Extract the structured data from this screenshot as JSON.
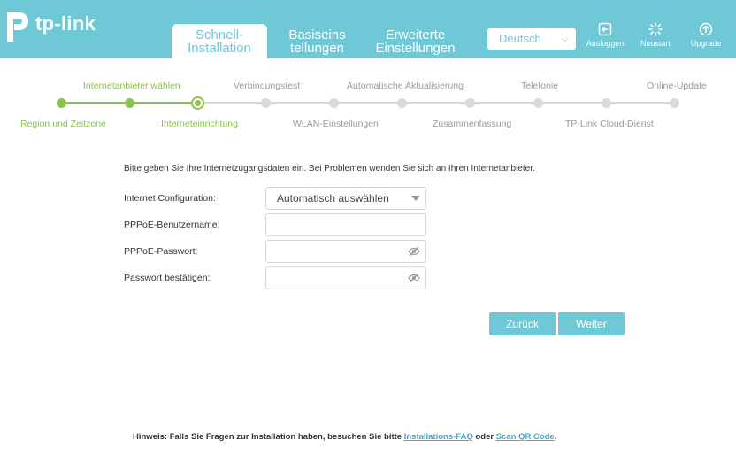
{
  "header": {
    "logo_text": "tp-link",
    "tabs": [
      {
        "line1": "Schnell-",
        "line2": "Installation"
      },
      {
        "line1": "Basiseins",
        "line2": "tellungen"
      },
      {
        "line1": "Erweiterte",
        "line2": "Einstellungen"
      }
    ],
    "language": "Deutsch",
    "buttons": {
      "logout": "Ausloggen",
      "reboot": "Neustart",
      "upgrade": "Upgrade"
    }
  },
  "steps": {
    "top": [
      "Internetanbieter wählen",
      "Verbindungstest",
      "Automatische Aktualisierung",
      "Telefonie",
      "Online-Update"
    ],
    "bottom": [
      "Region und Zeitzone",
      "Interneteinrichtung",
      "WLAN-Einstellungen",
      "Zusammenfassung",
      "TP-Link Cloud-Dienst"
    ]
  },
  "form": {
    "intro": "Bitte geben Sie Ihre Internetzugangsdaten ein. Bei Problemen wenden Sie sich an Ihren Internetanbieter.",
    "config_label": "Internet Configuration:",
    "config_value": "Automatisch auswählen",
    "username_label": "PPPoE-Benutzername:",
    "password_label": "PPPoE-Passwort:",
    "confirm_label": "Passwort bestätigen:",
    "username_value": "",
    "password_value": "",
    "confirm_value": ""
  },
  "actions": {
    "back": "Zurück",
    "next": "Weiter"
  },
  "footer": {
    "prefix": "Hinweis: Falls Sie Fragen zur Installation haben, besuchen Sie bitte",
    "faq_link": "Installations-FAQ",
    "middle": "oder",
    "qr_link": "Scan QR Code",
    "suffix": "."
  },
  "colors": {
    "brand": "#6ec8d5",
    "progress": "#8bc34a"
  }
}
